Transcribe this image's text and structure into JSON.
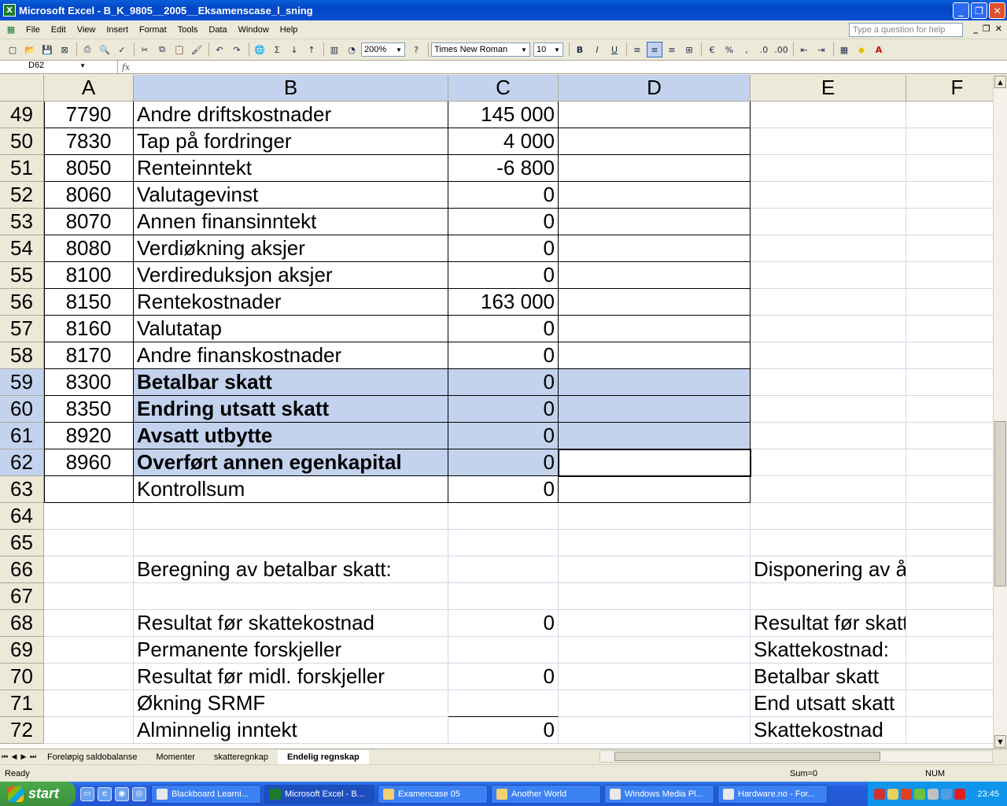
{
  "window": {
    "title": "Microsoft Excel - B_K_9805__2005__Eksamenscase_l_sning",
    "app_icon": "excel-icon"
  },
  "menu": [
    "File",
    "Edit",
    "View",
    "Insert",
    "Format",
    "Tools",
    "Data",
    "Window",
    "Help"
  ],
  "help_placeholder": "Type a question for help",
  "toolbar": {
    "zoom": "200%",
    "font": "Times New Roman",
    "size": "10"
  },
  "formula": {
    "namebox": "D62",
    "fx": "fx",
    "content": ""
  },
  "columns": [
    "A",
    "B",
    "C",
    "D",
    "E",
    "F"
  ],
  "rows": [
    {
      "n": "49",
      "a": "7790",
      "b": "Andre driftskostnader",
      "c": "145 000",
      "e": ""
    },
    {
      "n": "50",
      "a": "7830",
      "b": "Tap på fordringer",
      "c": "4 000",
      "e": ""
    },
    {
      "n": "51",
      "a": "8050",
      "b": "Renteinntekt",
      "c": "-6 800",
      "e": ""
    },
    {
      "n": "52",
      "a": "8060",
      "b": "Valutagevinst",
      "c": "0",
      "e": ""
    },
    {
      "n": "53",
      "a": "8070",
      "b": "Annen finansinntekt",
      "c": "0",
      "e": ""
    },
    {
      "n": "54",
      "a": "8080",
      "b": "Verdiøkning aksjer",
      "c": "0",
      "e": ""
    },
    {
      "n": "55",
      "a": "8100",
      "b": "Verdireduksjon aksjer",
      "c": "0",
      "e": ""
    },
    {
      "n": "56",
      "a": "8150",
      "b": "Rentekostnader",
      "c": "163 000",
      "e": ""
    },
    {
      "n": "57",
      "a": "8160",
      "b": "Valutatap",
      "c": "0",
      "e": ""
    },
    {
      "n": "58",
      "a": "8170",
      "b": "Andre finanskostnader",
      "c": "0",
      "e": ""
    },
    {
      "n": "59",
      "a": "8300",
      "b": "Betalbar skatt",
      "c": "0",
      "e": ""
    },
    {
      "n": "60",
      "a": "8350",
      "b": "Endring utsatt skatt",
      "c": "0",
      "e": ""
    },
    {
      "n": "61",
      "a": "8920",
      "b": "Avsatt utbytte",
      "c": "0",
      "e": ""
    },
    {
      "n": "62",
      "a": "8960",
      "b": "Overført annen egenkapital",
      "c": "0",
      "e": ""
    },
    {
      "n": "63",
      "a": "",
      "b": "Kontrollsum",
      "c": "0",
      "e": ""
    },
    {
      "n": "64",
      "a": "",
      "b": "",
      "c": "",
      "e": ""
    },
    {
      "n": "65",
      "a": "",
      "b": "",
      "c": "",
      "e": ""
    },
    {
      "n": "66",
      "a": "",
      "b": "Beregning av betalbar skatt:",
      "c": "",
      "e": "Disponering av årsoversk"
    },
    {
      "n": "67",
      "a": "",
      "b": "",
      "c": "",
      "e": ""
    },
    {
      "n": "68",
      "a": "",
      "b": "Resultat før skattekostnad",
      "c": "0",
      "e": "Resultat før skattekostna"
    },
    {
      "n": "69",
      "a": "",
      "b": "Permanente forskjeller",
      "c": "",
      "e": "Skattekostnad:"
    },
    {
      "n": "70",
      "a": "",
      "b": "Resultat før midl. forskjeller",
      "c": "0",
      "e": "Betalbar skatt"
    },
    {
      "n": "71",
      "a": "",
      "b": "Økning SRMF",
      "c": "",
      "e": "End utsatt skatt"
    },
    {
      "n": "72",
      "a": "",
      "b": "Alminnelig inntekt",
      "c": "0",
      "e": "Skattekostnad"
    }
  ],
  "sheet_tabs": [
    "Foreløpig saldobalanse",
    "Momenter",
    "skatteregnkap",
    "Endelig regnskap"
  ],
  "status": {
    "left": "Ready",
    "sum": "Sum=0",
    "num": "NUM"
  },
  "taskbar": {
    "start": "start",
    "tasks": [
      "Blackboard Learni...",
      "Microsoft Excel - B...",
      "Examencase 05",
      "Another World",
      "Windows Media Pl...",
      "Hardware.no - For..."
    ],
    "clock": "23:45"
  },
  "colors": {
    "selection": "#c3d3ee",
    "title_blue": "#0046c8",
    "taskbar_blue": "#245edc"
  }
}
